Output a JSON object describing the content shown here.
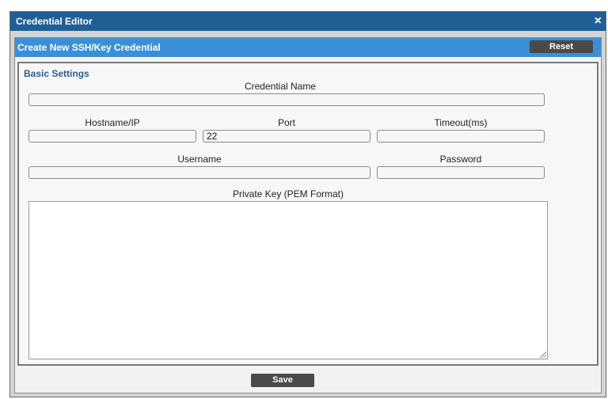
{
  "window": {
    "title": "Credential Editor",
    "close_glyph": "×"
  },
  "header": {
    "title": "Create New SSH/Key Credential",
    "reset_label": "Reset"
  },
  "form": {
    "section_title": "Basic Settings",
    "credential_name": {
      "label": "Credential Name",
      "value": ""
    },
    "hostname": {
      "label": "Hostname/IP",
      "value": ""
    },
    "port": {
      "label": "Port",
      "value": "22"
    },
    "timeout": {
      "label": "Timeout(ms)",
      "value": ""
    },
    "username": {
      "label": "Username",
      "value": ""
    },
    "password": {
      "label": "Password",
      "value": ""
    },
    "private_key": {
      "label": "Private Key (PEM Format)",
      "value": ""
    }
  },
  "footer": {
    "save_label": "Save"
  },
  "colors": {
    "titlebar": "#1f5f96",
    "subheader": "#3b8fd6",
    "button": "#4a4a4a",
    "section_title": "#2c5f8c"
  }
}
